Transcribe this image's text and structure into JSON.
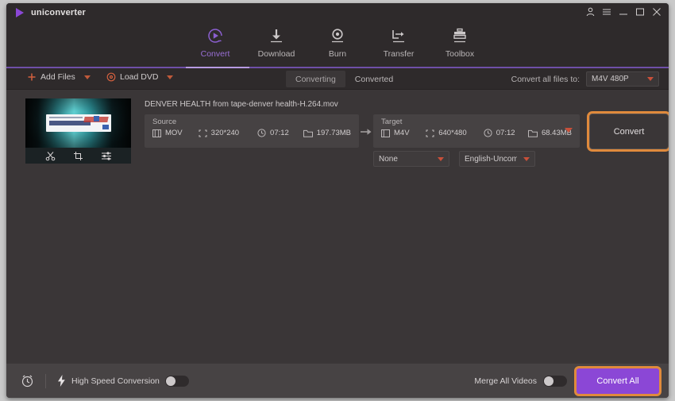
{
  "window": {
    "app_name": "uniconverter",
    "controls": [
      "account-icon",
      "menu-icon",
      "minimize-icon",
      "maximize-icon",
      "close-icon"
    ]
  },
  "nav": {
    "tabs": [
      {
        "label": "Convert",
        "icon": "convert-icon",
        "active": true
      },
      {
        "label": "Download",
        "icon": "download-icon",
        "active": false
      },
      {
        "label": "Burn",
        "icon": "burn-icon",
        "active": false
      },
      {
        "label": "Transfer",
        "icon": "transfer-icon",
        "active": false
      },
      {
        "label": "Toolbox",
        "icon": "toolbox-icon",
        "active": false
      }
    ]
  },
  "toolbar": {
    "add_files_label": "Add Files",
    "load_dvd_label": "Load DVD",
    "segments": [
      {
        "label": "Converting",
        "active": true
      },
      {
        "label": "Converted",
        "active": false
      }
    ],
    "convert_all_files_to_label": "Convert all files to:",
    "convert_all_files_to_value": "M4V 480P"
  },
  "file_card": {
    "filename": "DENVER HEALTH from tape-denver health-H.264.mov",
    "thumbnail_tools": [
      "trim-icon",
      "crop-icon",
      "effects-icon"
    ],
    "source": {
      "label": "Source",
      "format": "MOV",
      "resolution": "320*240",
      "duration": "07:12",
      "size": "197.73MB"
    },
    "target": {
      "label": "Target",
      "format": "M4V",
      "resolution": "640*480",
      "duration": "07:12",
      "size": "68.43MB"
    },
    "subtitle_select": "None",
    "audio_select": "English-Uncom...",
    "convert_button": "Convert"
  },
  "bottom": {
    "scheduler_icon": "alarm-clock-icon",
    "high_speed_label": "High Speed Conversion",
    "high_speed_on": false,
    "merge_label": "Merge All Videos",
    "merge_on": false,
    "convert_all_label": "Convert All"
  },
  "colors": {
    "accent_purple": "#8b47d6",
    "highlight_orange": "#e08a3c",
    "caret_red": "#c9503a",
    "window_bg": "#2e2a2b",
    "content_bg": "#3a3637"
  }
}
